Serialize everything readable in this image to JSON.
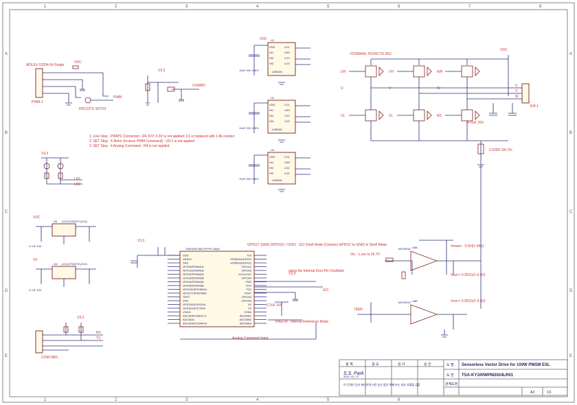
{
  "frame": {
    "col_markers": [
      "1",
      "2",
      "3",
      "4",
      "5",
      "6",
      "7",
      "8"
    ],
    "row_markers": [
      "A",
      "B",
      "C",
      "D",
      "E"
    ]
  },
  "connectors": {
    "pwm_header": {
      "ref": "PWM-1",
      "name": "MOLEX 53254-04 Single"
    },
    "motor_header": {
      "ref": "EM-1",
      "pins": [
        "U",
        "V",
        "W"
      ]
    },
    "com_header": {
      "ref": "COM-DBG"
    }
  },
  "gate_driver": {
    "refs": [
      "U1",
      "U2",
      "U3"
    ],
    "ic_pins_left": [
      "VDD",
      "HI1",
      "HI2",
      "HI3"
    ],
    "ic_pins_right": [
      "LO1",
      "VSS",
      "LO2",
      "LO3"
    ],
    "chip": "LM5106",
    "cap_value": "10uF 25V 105%"
  },
  "bridge": {
    "part_name": "FDD8444L 25V/4C7/0.25Ω",
    "phases": [
      "UH",
      "VH",
      "WH"
    ],
    "low_phases": [
      "UL",
      "VL",
      "WL"
    ],
    "bus_cap": "470uF 25V",
    "shunt": "0.025R 1W 1%"
  },
  "mcu": {
    "ref": "U4",
    "name": "TMS320F28027PTPK 38QF",
    "left_pins": [
      "VDD",
      "VDDIO",
      "XRS",
      "GPIO0/EPWM1A",
      "GPIO1/EPWM1B",
      "GPIO2/EPWM2A",
      "GPIO3/EPWM2B",
      "GPIO4/EPWM3A",
      "GPIO5/EPWM3B",
      "GPIO16/SPISIMOA",
      "GPIO17/SPISOMIA",
      "TEST",
      "VSS",
      "GPIO28/SCIRXDA",
      "GPIO29/SCITXDA",
      "VDDA",
      "ADCINA0/VREFLO",
      "ADCINA1",
      "ADCINA2/COMP1A"
    ],
    "right_pins": [
      "TDI",
      "EPWM1A/GPIO0",
      "EPWM1B/GPIO1",
      "GPIO12",
      "GPIO18",
      "XCLKOUT",
      "GPIO34",
      "TMS",
      "TDO",
      "TCK",
      "TRST",
      "GPIO32",
      "GPIO33",
      "X1",
      "X2",
      "VSSA",
      "ADCINB1",
      "ADCINB2",
      "ADCINB4"
    ]
  },
  "notes": {
    "pwm_notes": [
      "1. Line Step : PWM'S Connected : R4 3V3~3.3V is not applied; C1 is replaced with 1.8k resistor",
      "2. SET Step : 4 Motor (Inverse PWM Command) : U3-1 is not applied",
      "3. SET Step : 4 Analog Command : R4 is not applied"
    ],
    "oscillator_note": "using the Internal Zero-Pin Oscillator",
    "mode_note": "GPIO17 (GND-GPIO16) / VDD1 : SCI Stroll Mode (Connect GPIO17 to GND) in Stroll Mode",
    "vref_note": "VREF26 : Internal Reference Mode",
    "analog_note": "Analog Command Input",
    "bus_note": "Vin : 1.xxx to 25.7V",
    "current_note": "Vmotor : 3.3V(0~24V)",
    "amp_note1": "Vout = 0.25V(x2~3.3V)",
    "amp_note2": "Vout = 0.25V(x2~3.3V)"
  },
  "regulators": {
    "reg1": {
      "ref": "U5",
      "name": "LD1117S33TR (3V3)",
      "cap": "4.7uF 10V"
    },
    "reg2": {
      "ref": "U6",
      "name": "LD1117S33TR (3V3)",
      "cap": "4.7uF 10V"
    }
  },
  "opamps": {
    "amp1": {
      "ref": "U8A",
      "name": "MCP6292"
    },
    "amp2": {
      "ref": "U8B",
      "name": "MCP6292"
    }
  },
  "title_block": {
    "header_cells": [
      "설 계",
      "검 도",
      "심 사",
      "승 인"
    ],
    "designer": "S.S. Park",
    "date": "2012. 02. 27",
    "doc_label": "도 명",
    "doc_title": "Sensorless Vector Drive for 100W PMSM ESL",
    "num_label": "도 번",
    "doc_number": "TSA-KY100WPM2024LR01",
    "ref_label": "관계도번",
    "size": "A3",
    "sheet": "1/1",
    "notice": "이 도면은 당사 재산이며 사전 승인 없이 복제 또는 외부 유출을 금함"
  }
}
